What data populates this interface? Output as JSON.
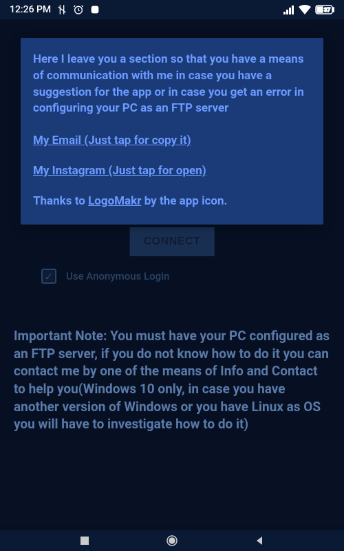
{
  "status_bar": {
    "time": "12:26 PM",
    "battery": "37"
  },
  "info": {
    "intro": "Here I leave you a section so that you have a means of communication with me in case you have a suggestion for the app or in case you get an error in configuring your PC as an FTP server",
    "email_link": "My Email (Just tap for copy it)",
    "instagram_link": "My Instagram (Just tap for open)",
    "thanks_prefix": "Thanks to ",
    "thanks_link": "LogoMakr",
    "thanks_suffix": " by the app icon."
  },
  "connect_button": "CONNECT",
  "anonymous_login_label": "Use Anonymous Login",
  "important_note": "Important Note: You must have your PC configured as an FTP server, if you do not know how to do it you can contact me by one of the means of Info and Contact to help you(Windows 10 only, in case you have another version of Windows or you have Linux as OS you will have to investigate how to do it)"
}
